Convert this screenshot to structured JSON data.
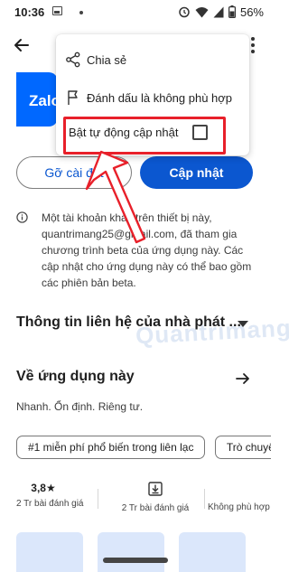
{
  "status_bar": {
    "time": "10:36",
    "battery_percent": "56%",
    "icons": [
      "image-icon",
      "dot-icon",
      "alarm-icon",
      "wifi-icon",
      "signal-icon",
      "battery-icon"
    ]
  },
  "app": {
    "icon_text": "Zalo",
    "brand_color": "#0068ff"
  },
  "buttons": {
    "uninstall_label": "Gỡ cài đặt",
    "update_label": "Cập nhật",
    "accent_color": "#0b57d0"
  },
  "menu": {
    "items": [
      {
        "label": "Chia sẻ",
        "icon": "share-icon"
      },
      {
        "label": "Đánh dấu là không phù hợp",
        "icon": "flag-icon"
      },
      {
        "label": "Bật tự động cập nhật",
        "icon": "checkbox-icon",
        "checked": false
      }
    ]
  },
  "info": {
    "text": "Một tài khoản khác trên thiết bị này, quantrimang25@gmail.com, đã tham gia chương trình beta của ứng dụng này. Các cập nhật cho ứng dụng này có thể bao gồm các phiên bản beta."
  },
  "contact": {
    "title": "Thông tin liên hệ của nhà phát ..."
  },
  "about": {
    "title": "Về ứng dụng này",
    "description": "Nhanh. Ổn định. Riêng tư."
  },
  "chips": [
    {
      "label": "#1 miễn phí phổ biến trong liên lạc"
    },
    {
      "label": "Trò chuyện"
    }
  ],
  "stats": {
    "rating": "3,8★",
    "rating_count": "2 Tr bài đánh giá",
    "downloads_sub": "2 Tr bài đánh giá",
    "age": "Không phù hợp"
  },
  "watermark": "Quantrimang",
  "annotation": {
    "highlight_color": "#e8202a"
  }
}
